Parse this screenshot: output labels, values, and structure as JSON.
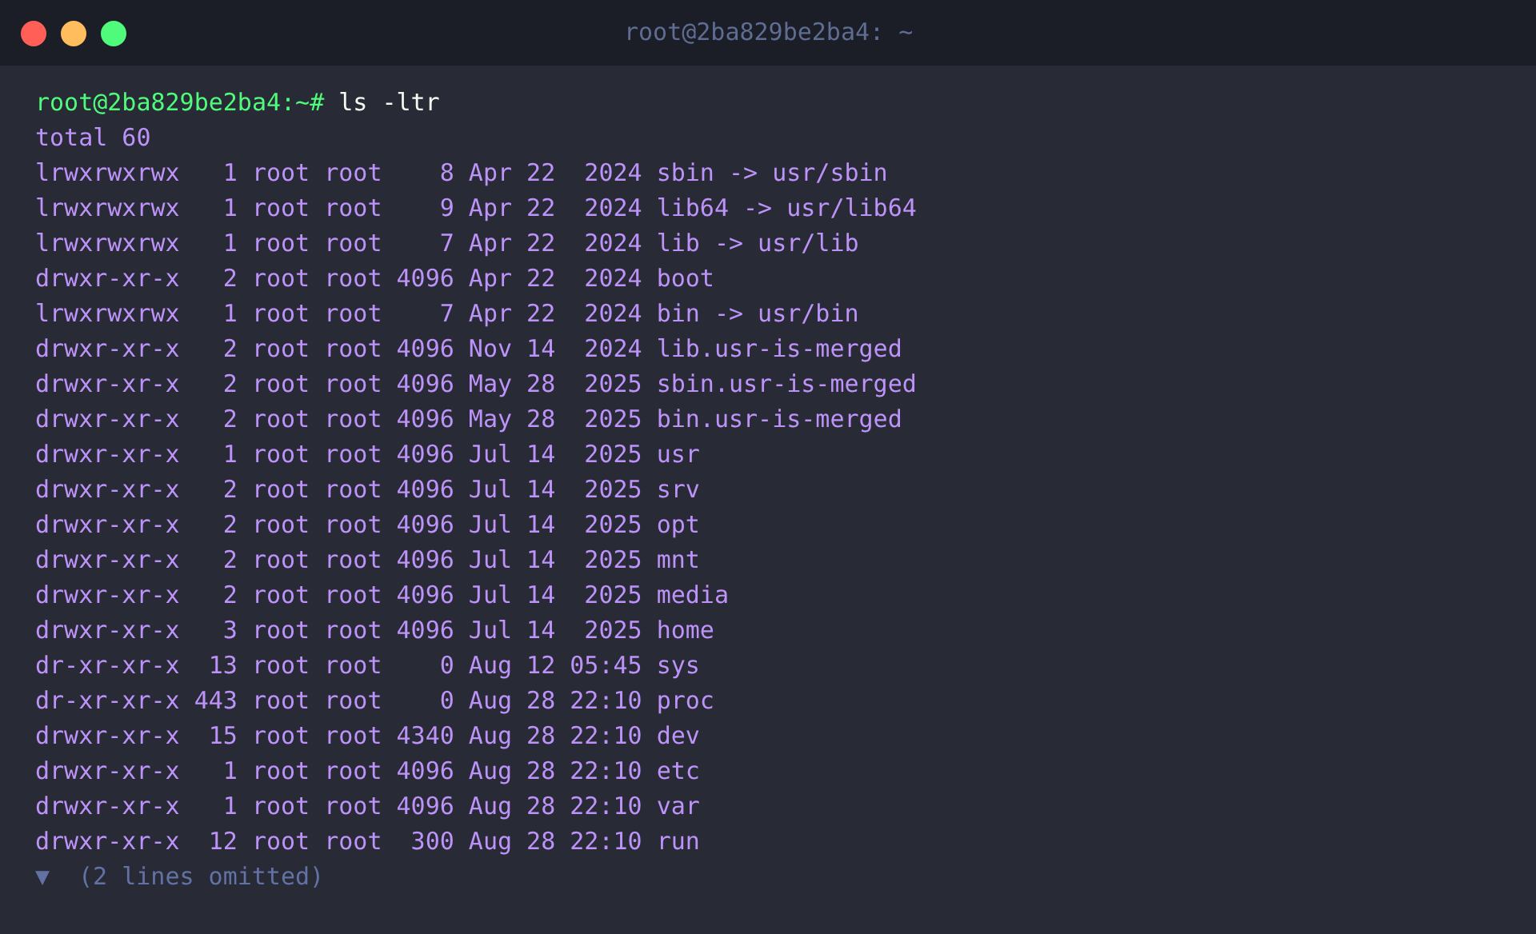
{
  "window": {
    "title": "root@2ba829be2ba4: ~"
  },
  "prompt": {
    "text": "root@2ba829be2ba4:~#",
    "command": "ls -ltr"
  },
  "output_lines": [
    "total 60",
    "lrwxrwxrwx   1 root root    8 Apr 22  2024 sbin -> usr/sbin",
    "lrwxrwxrwx   1 root root    9 Apr 22  2024 lib64 -> usr/lib64",
    "lrwxrwxrwx   1 root root    7 Apr 22  2024 lib -> usr/lib",
    "drwxr-xr-x   2 root root 4096 Apr 22  2024 boot",
    "lrwxrwxrwx   1 root root    7 Apr 22  2024 bin -> usr/bin",
    "drwxr-xr-x   2 root root 4096 Nov 14  2024 lib.usr-is-merged",
    "drwxr-xr-x   2 root root 4096 May 28  2025 sbin.usr-is-merged",
    "drwxr-xr-x   2 root root 4096 May 28  2025 bin.usr-is-merged",
    "drwxr-xr-x   1 root root 4096 Jul 14  2025 usr",
    "drwxr-xr-x   2 root root 4096 Jul 14  2025 srv",
    "drwxr-xr-x   2 root root 4096 Jul 14  2025 opt",
    "drwxr-xr-x   2 root root 4096 Jul 14  2025 mnt",
    "drwxr-xr-x   2 root root 4096 Jul 14  2025 media",
    "drwxr-xr-x   3 root root 4096 Jul 14  2025 home",
    "dr-xr-xr-x  13 root root    0 Aug 12 05:45 sys",
    "dr-xr-xr-x 443 root root    0 Aug 28 22:10 proc",
    "drwxr-xr-x  15 root root 4340 Aug 28 22:10 dev",
    "drwxr-xr-x   1 root root 4096 Aug 28 22:10 etc",
    "drwxr-xr-x   1 root root 4096 Aug 28 22:10 var",
    "drwxr-xr-x  12 root root  300 Aug 28 22:10 run"
  ],
  "omitted": {
    "toggle": "▼",
    "label": "(2 lines omitted)",
    "expanded": false
  }
}
